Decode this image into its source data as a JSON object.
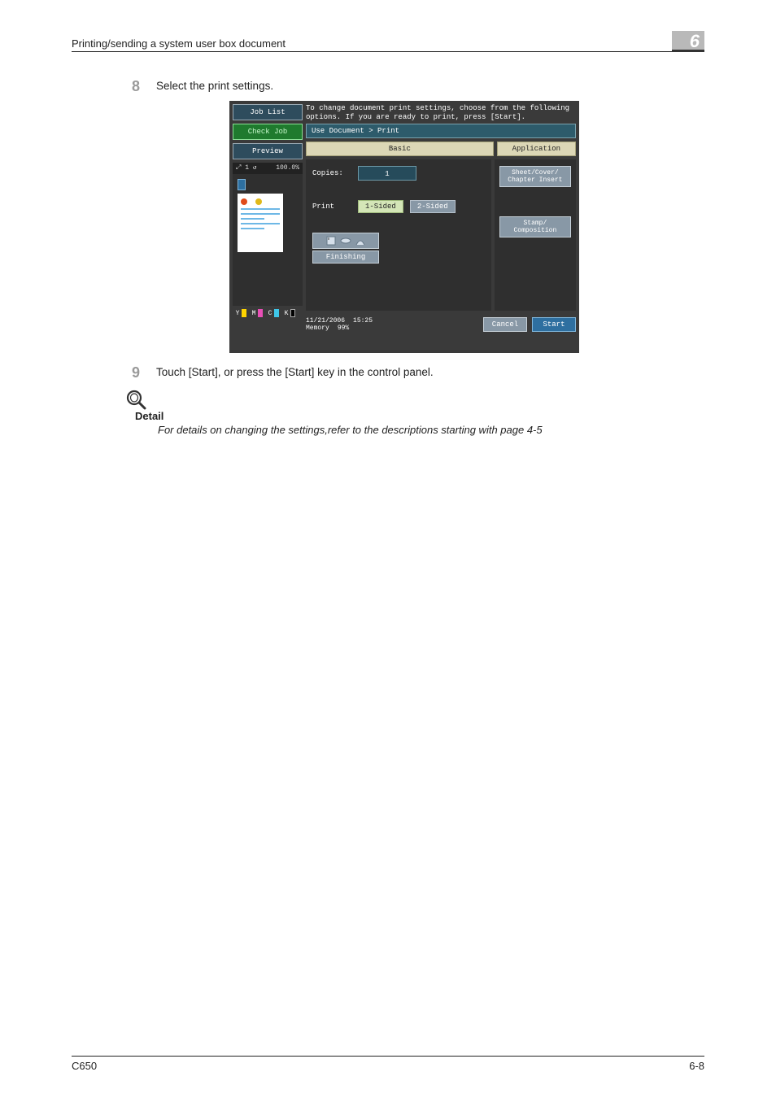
{
  "header": {
    "title": "Printing/sending a system user box document",
    "chapter": "6"
  },
  "steps": [
    {
      "num": "8",
      "text": "Select the print settings."
    },
    {
      "num": "9",
      "text": "Touch [Start], or press the [Start] key in the control panel."
    }
  ],
  "note": {
    "title": "Detail",
    "text": "For details on changing the settings,refer to the descriptions starting with page 4-5"
  },
  "footer": {
    "left": "C650",
    "right": "6-8"
  },
  "screen": {
    "sidebar": {
      "job_list": "Job List",
      "check_job": "Check Job",
      "preview": "Preview",
      "zoom_left": "⤢ 1 ↺",
      "zoom_right": "100.0%",
      "toner": [
        "Y",
        "M",
        "C",
        "K"
      ]
    },
    "instruction": "To change document print settings, choose from the following\noptions. If you are ready to print, press [Start].",
    "breadcrumb": "Use Document > Print",
    "tabs": {
      "basic": "Basic",
      "application": "Application"
    },
    "basic": {
      "copies_label": "Copies:",
      "copies_value": "1",
      "print_label": "Print",
      "one_sided": "1-Sided",
      "two_sided": "2-Sided",
      "finishing": "Finishing"
    },
    "application": {
      "sheet_cover": "Sheet/Cover/\nChapter Insert",
      "stamp": "Stamp/\nComposition"
    },
    "bottom": {
      "date": "11/21/2006",
      "time": "15:25",
      "memory_label": "Memory",
      "memory_value": "99%",
      "cancel": "Cancel",
      "start": "Start"
    }
  }
}
